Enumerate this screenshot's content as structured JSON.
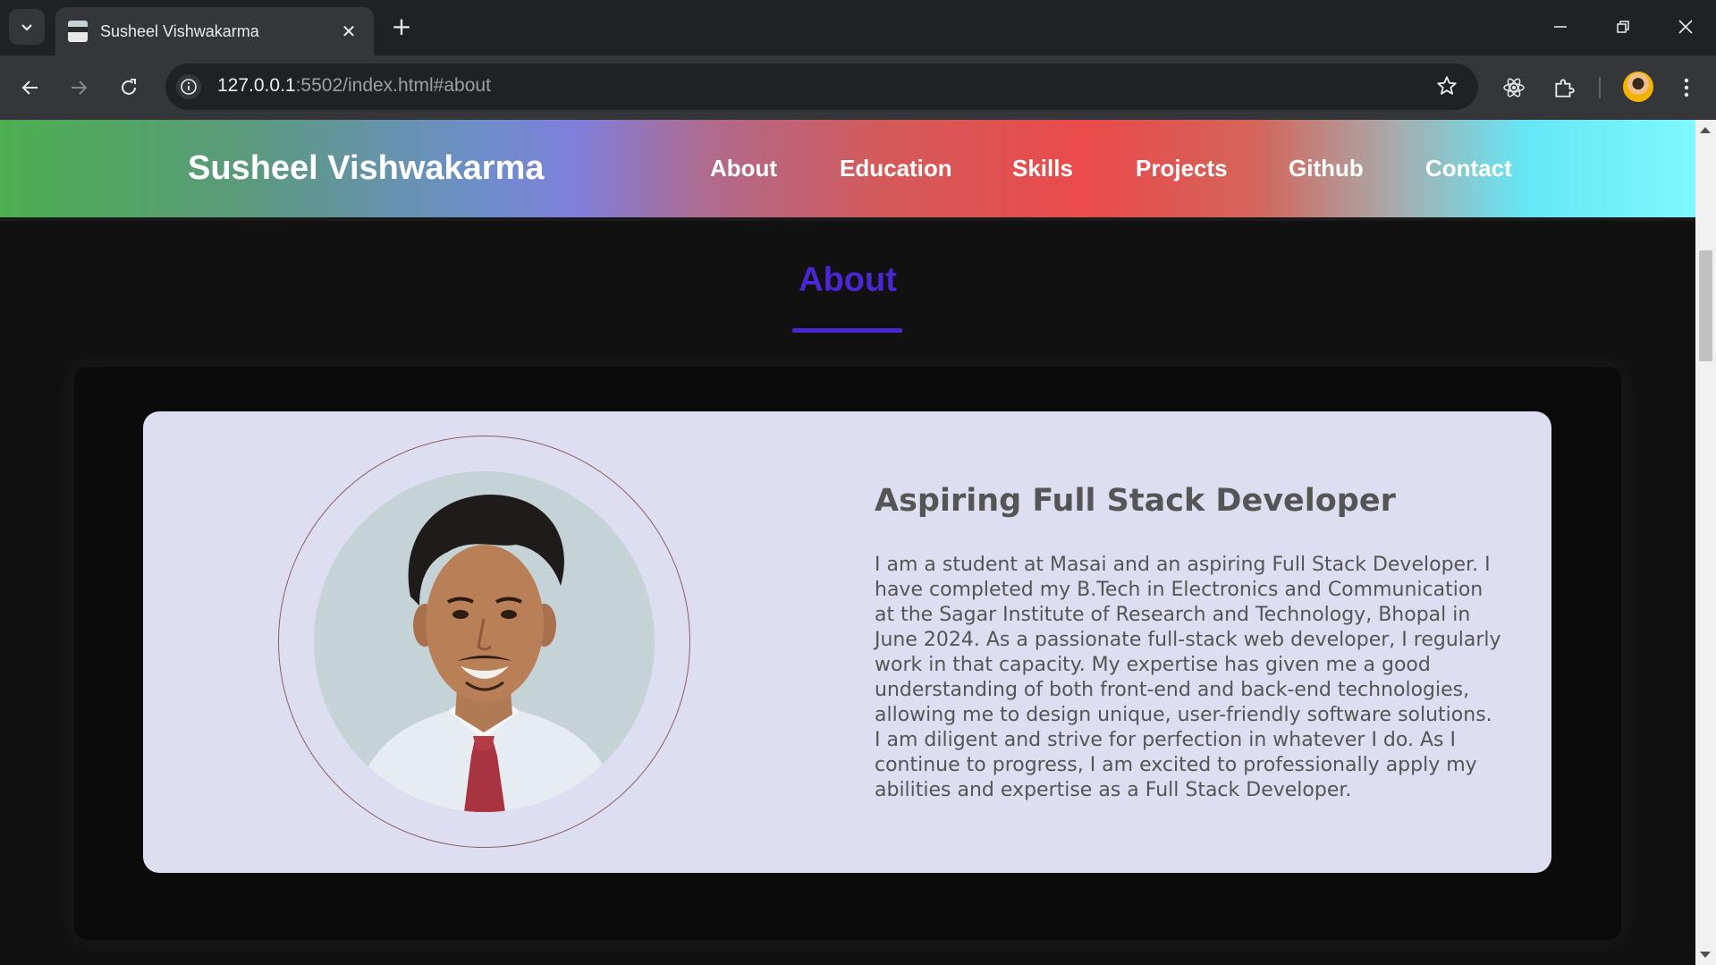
{
  "browser": {
    "tab_title": "Susheel Vishwakarma",
    "url_host": "127.0.0.1",
    "url_path": ":5502/index.html#about"
  },
  "site": {
    "brand": "Susheel Vishwakarma",
    "nav": [
      "About",
      "Education",
      "Skills",
      "Projects",
      "Github",
      "Contact"
    ],
    "header_gradient": [
      "#4caf50",
      "#7f7fdc",
      "#ea4a4a",
      "#7ff8ff"
    ]
  },
  "about": {
    "section_title": "About",
    "accent_color": "#4a26d6",
    "heading": "Aspiring Full Stack Developer",
    "lines": [
      "I am a student at Masai and an aspiring Full Stack Developer. I",
      "have completed my B.Tech in Electronics and Communication",
      "at the Sagar Institute of Research and Technology, Bhopal in",
      "June 2024. As a passionate full-stack web developer, I regularly",
      "work in that capacity. My expertise has given me a good",
      "understanding of both front-end and back-end technologies,",
      "allowing me to design unique, user-friendly software solutions.",
      "I am diligent and strive for perfection in whatever I do. As I",
      "continue to progress, I am excited to professionally apply my",
      "abilities and expertise as a Full Stack Developer."
    ]
  }
}
